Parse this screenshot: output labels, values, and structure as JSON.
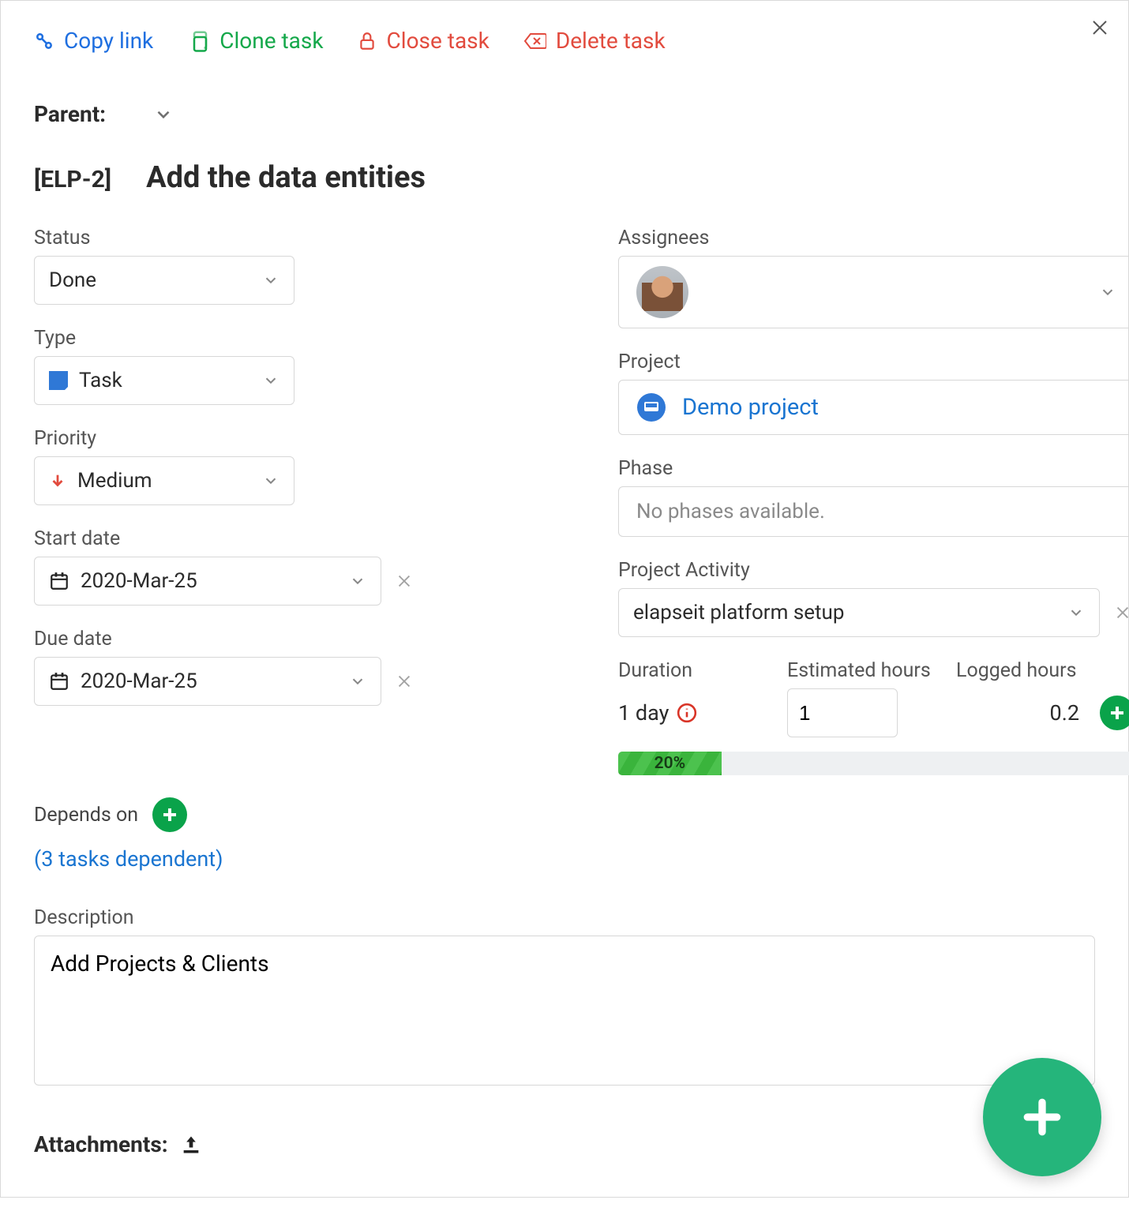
{
  "actions": {
    "copy_link": "Copy link",
    "clone_task": "Clone task",
    "close_task": "Close task",
    "delete_task": "Delete task"
  },
  "parent": {
    "label": "Parent:"
  },
  "task": {
    "id": "[ELP-2]",
    "title": "Add the data entities"
  },
  "left": {
    "status": {
      "label": "Status",
      "value": "Done"
    },
    "type": {
      "label": "Type",
      "value": "Task"
    },
    "priority": {
      "label": "Priority",
      "value": "Medium"
    },
    "start_date": {
      "label": "Start date",
      "value": "2020-Mar-25"
    },
    "due_date": {
      "label": "Due date",
      "value": "2020-Mar-25"
    }
  },
  "right": {
    "assignees": {
      "label": "Assignees"
    },
    "project": {
      "label": "Project",
      "value": "Demo project"
    },
    "phase": {
      "label": "Phase",
      "placeholder": "No phases available."
    },
    "project_activity": {
      "label": "Project Activity",
      "value": "elapseit platform setup"
    },
    "duration": {
      "label": "Duration",
      "value": "1 day"
    },
    "estimated": {
      "label": "Estimated hours",
      "value": "1"
    },
    "logged": {
      "label": "Logged hours",
      "value": "0.2"
    },
    "progress": {
      "percent": 20,
      "label": "20%"
    }
  },
  "depends": {
    "label": "Depends on",
    "link": "(3 tasks dependent)"
  },
  "description": {
    "label": "Description",
    "value": "Add Projects & Clients"
  },
  "attachments": {
    "label": "Attachments:"
  }
}
